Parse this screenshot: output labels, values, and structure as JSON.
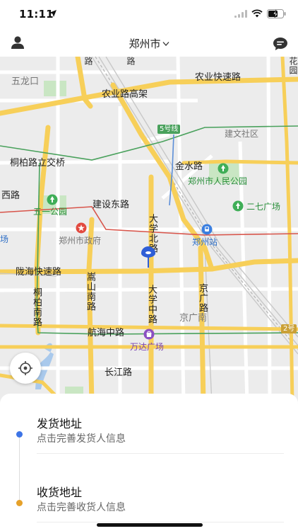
{
  "status_bar": {
    "time": "11:11"
  },
  "header": {
    "city": "郑州市"
  },
  "map": {
    "labels": {
      "wulongkou": "五龙口",
      "nongye_expressway": "农业快速路",
      "nongye_elevated": "农业路高架",
      "jianwen": "建文社区",
      "tongbai_interchange": "桐柏路立交桥",
      "jinshui_road": "金水路",
      "renmin_park": "郑州市人民公园",
      "xi_road": "西路",
      "wuyi_park": "五一公园",
      "jianshe_east": "建设东路",
      "erqi_square": "二七广场",
      "chang": "场",
      "gov": "郑州市政府",
      "zhengzhou_station": "郑州站",
      "longhai_expressway": "陇海快速路",
      "tongbai_south": "桐柏南路",
      "songshan_south": "嵩山南路",
      "daxue_north": "大学北路",
      "daxue_middle": "大学中路",
      "jingguang_road": "京广路",
      "jingguang_south": "京广南",
      "hanghai_middle": "航海中路",
      "wanda_plaza": "万达广场",
      "changjiang_road": "长江路",
      "hua_yuan": "花园",
      "lu_top": "路",
      "lu_top2": "路",
      "line5": "5号线",
      "line2": "2号"
    }
  },
  "sheet": {
    "ship": {
      "title": "发货地址",
      "subtitle": "点击完善发货人信息"
    },
    "recv": {
      "title": "收货地址",
      "subtitle": "点击完善收货人信息"
    }
  },
  "colors": {
    "ship_dot": "#3d74e6",
    "recv_dot": "#e6a12a",
    "road_major": "#f7cf59",
    "metro_line5": "#49a15c"
  }
}
